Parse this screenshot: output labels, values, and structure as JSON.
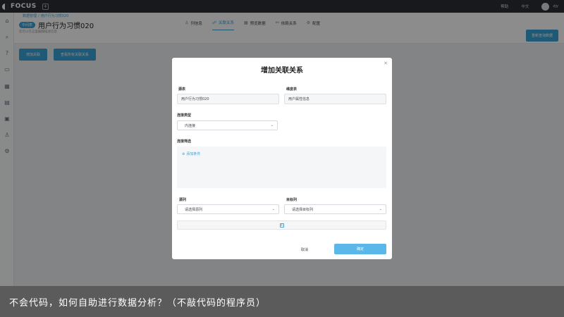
{
  "topbar": {
    "logo": "FOCUS",
    "new_tab_icon": "plus-square-icon",
    "help": "帮助",
    "language": "中文",
    "username": "zjy"
  },
  "sidebar": {
    "icons": [
      "home-icon",
      "search-icon",
      "question-icon",
      "dashboard-icon",
      "table-icon",
      "folder-icon",
      "calendar-icon",
      "user-icon",
      "settings-icon"
    ]
  },
  "header": {
    "breadcrumb": [
      "数据管理",
      "用户行为习惯020"
    ],
    "tag": "中间表",
    "title": "用户行为习惯020",
    "description": "您可以在这里编辑描述信息",
    "tabs": [
      {
        "label": "列信息",
        "icon": "user-icon"
      },
      {
        "label": "关联关系",
        "icon": "link-icon"
      },
      {
        "label": "预览数据",
        "icon": "table-icon"
      },
      {
        "label": "依赖关系",
        "icon": "link-icon"
      },
      {
        "label": "配置",
        "icon": "gear-icon"
      }
    ],
    "active_tab": 1,
    "refresh_button": "重新查询数据"
  },
  "actions": {
    "add_relation": "增加关联",
    "view_all": "查看所有关联关系"
  },
  "modal": {
    "title": "增加关联关系",
    "source_label": "源表",
    "source_value": "用户行为习惯020",
    "dim_label": "维度表",
    "dim_value": "用户属性信息",
    "join_label": "连接类型",
    "join_value": "内连接",
    "filter_label": "连接筛选",
    "add_condition": "添加条件",
    "source_col_label": "源列",
    "source_col_placeholder": "请选择源列",
    "target_col_label": "目标列",
    "target_col_placeholder": "请选择目标列",
    "cancel": "取消",
    "confirm": "确定"
  },
  "caption": "不会代码，如何自助进行数据分析？（不敲代码的程序员）",
  "colors": {
    "accent": "#3aa3d8",
    "topbar": "#2b2f36",
    "caption_bg": "#585858"
  }
}
